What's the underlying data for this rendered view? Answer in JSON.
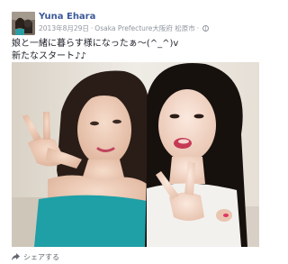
{
  "post": {
    "author": "Yuna Ehara",
    "date": "2013年8月29日",
    "separator": "·",
    "location": "Osaka Prefecture大阪府 松原市",
    "location_tail": "·",
    "privacy_icon": "globe-icon",
    "text_line_1": "娘と一緒に暮らす様になったぁ〜(^_^)v",
    "text_line_2": "新たなスタート♪♪"
  },
  "actions": {
    "share_label": "シェアする",
    "share_icon": "share-icon"
  },
  "colors": {
    "author_link": "#3b5998",
    "meta_text": "#8f959e",
    "body_text": "#1d2129"
  }
}
